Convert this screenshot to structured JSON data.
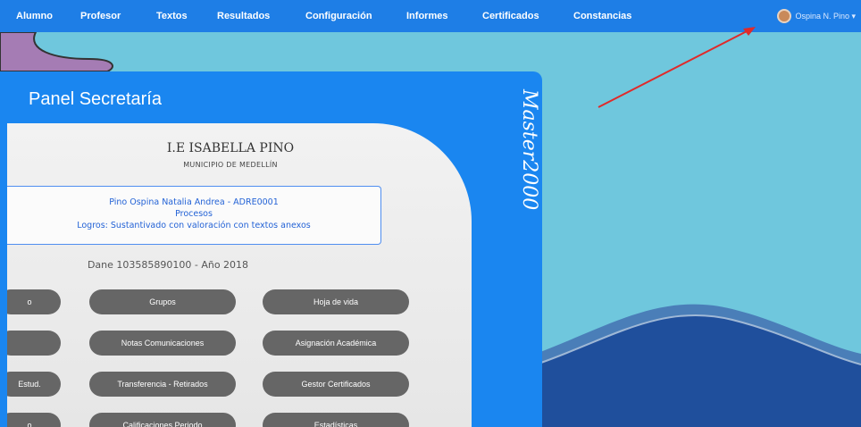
{
  "nav": {
    "items": [
      "Alumno",
      "Profesor",
      "Textos",
      "Resultados",
      "Configuración",
      "Informes",
      "Certificados",
      "Constancias"
    ],
    "user_name": "Ospina N. Pino ▾"
  },
  "panel": {
    "title": "Panel Secretaría",
    "brand": "Master2000",
    "school_name": "I.E ISABELLA PINO",
    "municipality": "MUNICIPIO DE MEDELLÍN",
    "info": {
      "line1": "Pino Ospina Natalia Andrea - ADRE0001",
      "line2": "Procesos",
      "line3": "Logros: Sustantivado con valoración con textos anexos"
    },
    "dane": "Dane 103585890100 - Año 2018"
  },
  "buttons": {
    "row1": [
      "o",
      "Grupos",
      "Hoja de vida"
    ],
    "row2": [
      "",
      "Notas Comunicaciones",
      "Asignación Académica"
    ],
    "row3": [
      "Estud.",
      "Transferencia - Retirados",
      "Gestor Certificados"
    ],
    "row4": [
      "o",
      "Calificaciones Periodo",
      "Estadísticas"
    ]
  },
  "colors": {
    "nav_bg": "#1e7ee6",
    "panel_bg": "#1a86f0",
    "button_bg": "#666666",
    "arrow": "#e02a2a"
  }
}
